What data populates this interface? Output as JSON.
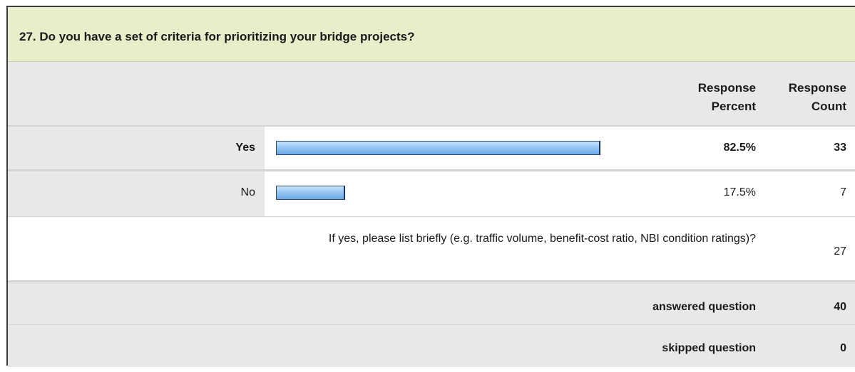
{
  "question": {
    "title": "27. Do you have a set of criteria for prioritizing your bridge projects?"
  },
  "header": {
    "percent_label_line1": "Response",
    "percent_label_line2": "Percent",
    "count_label_line1": "Response",
    "count_label_line2": "Count"
  },
  "answers": [
    {
      "label": "Yes",
      "percent": "82.5%",
      "percent_value": 82.5,
      "count": "33"
    },
    {
      "label": "No",
      "percent": "17.5%",
      "percent_value": 17.5,
      "count": "7"
    }
  ],
  "other": {
    "text": "If yes, please list briefly (e.g. traffic volume, benefit-cost ratio, NBI condition ratings)?",
    "count": "27"
  },
  "summary": {
    "answered_label": "answered question",
    "answered_count": "40",
    "skipped_label": "skipped question",
    "skipped_count": "0"
  },
  "colors": {
    "title_bg": "#e6eeca",
    "row_bg": "#e8e8e8",
    "bar_fill": "#93c4f1",
    "bar_border": "#2a4a78"
  }
}
